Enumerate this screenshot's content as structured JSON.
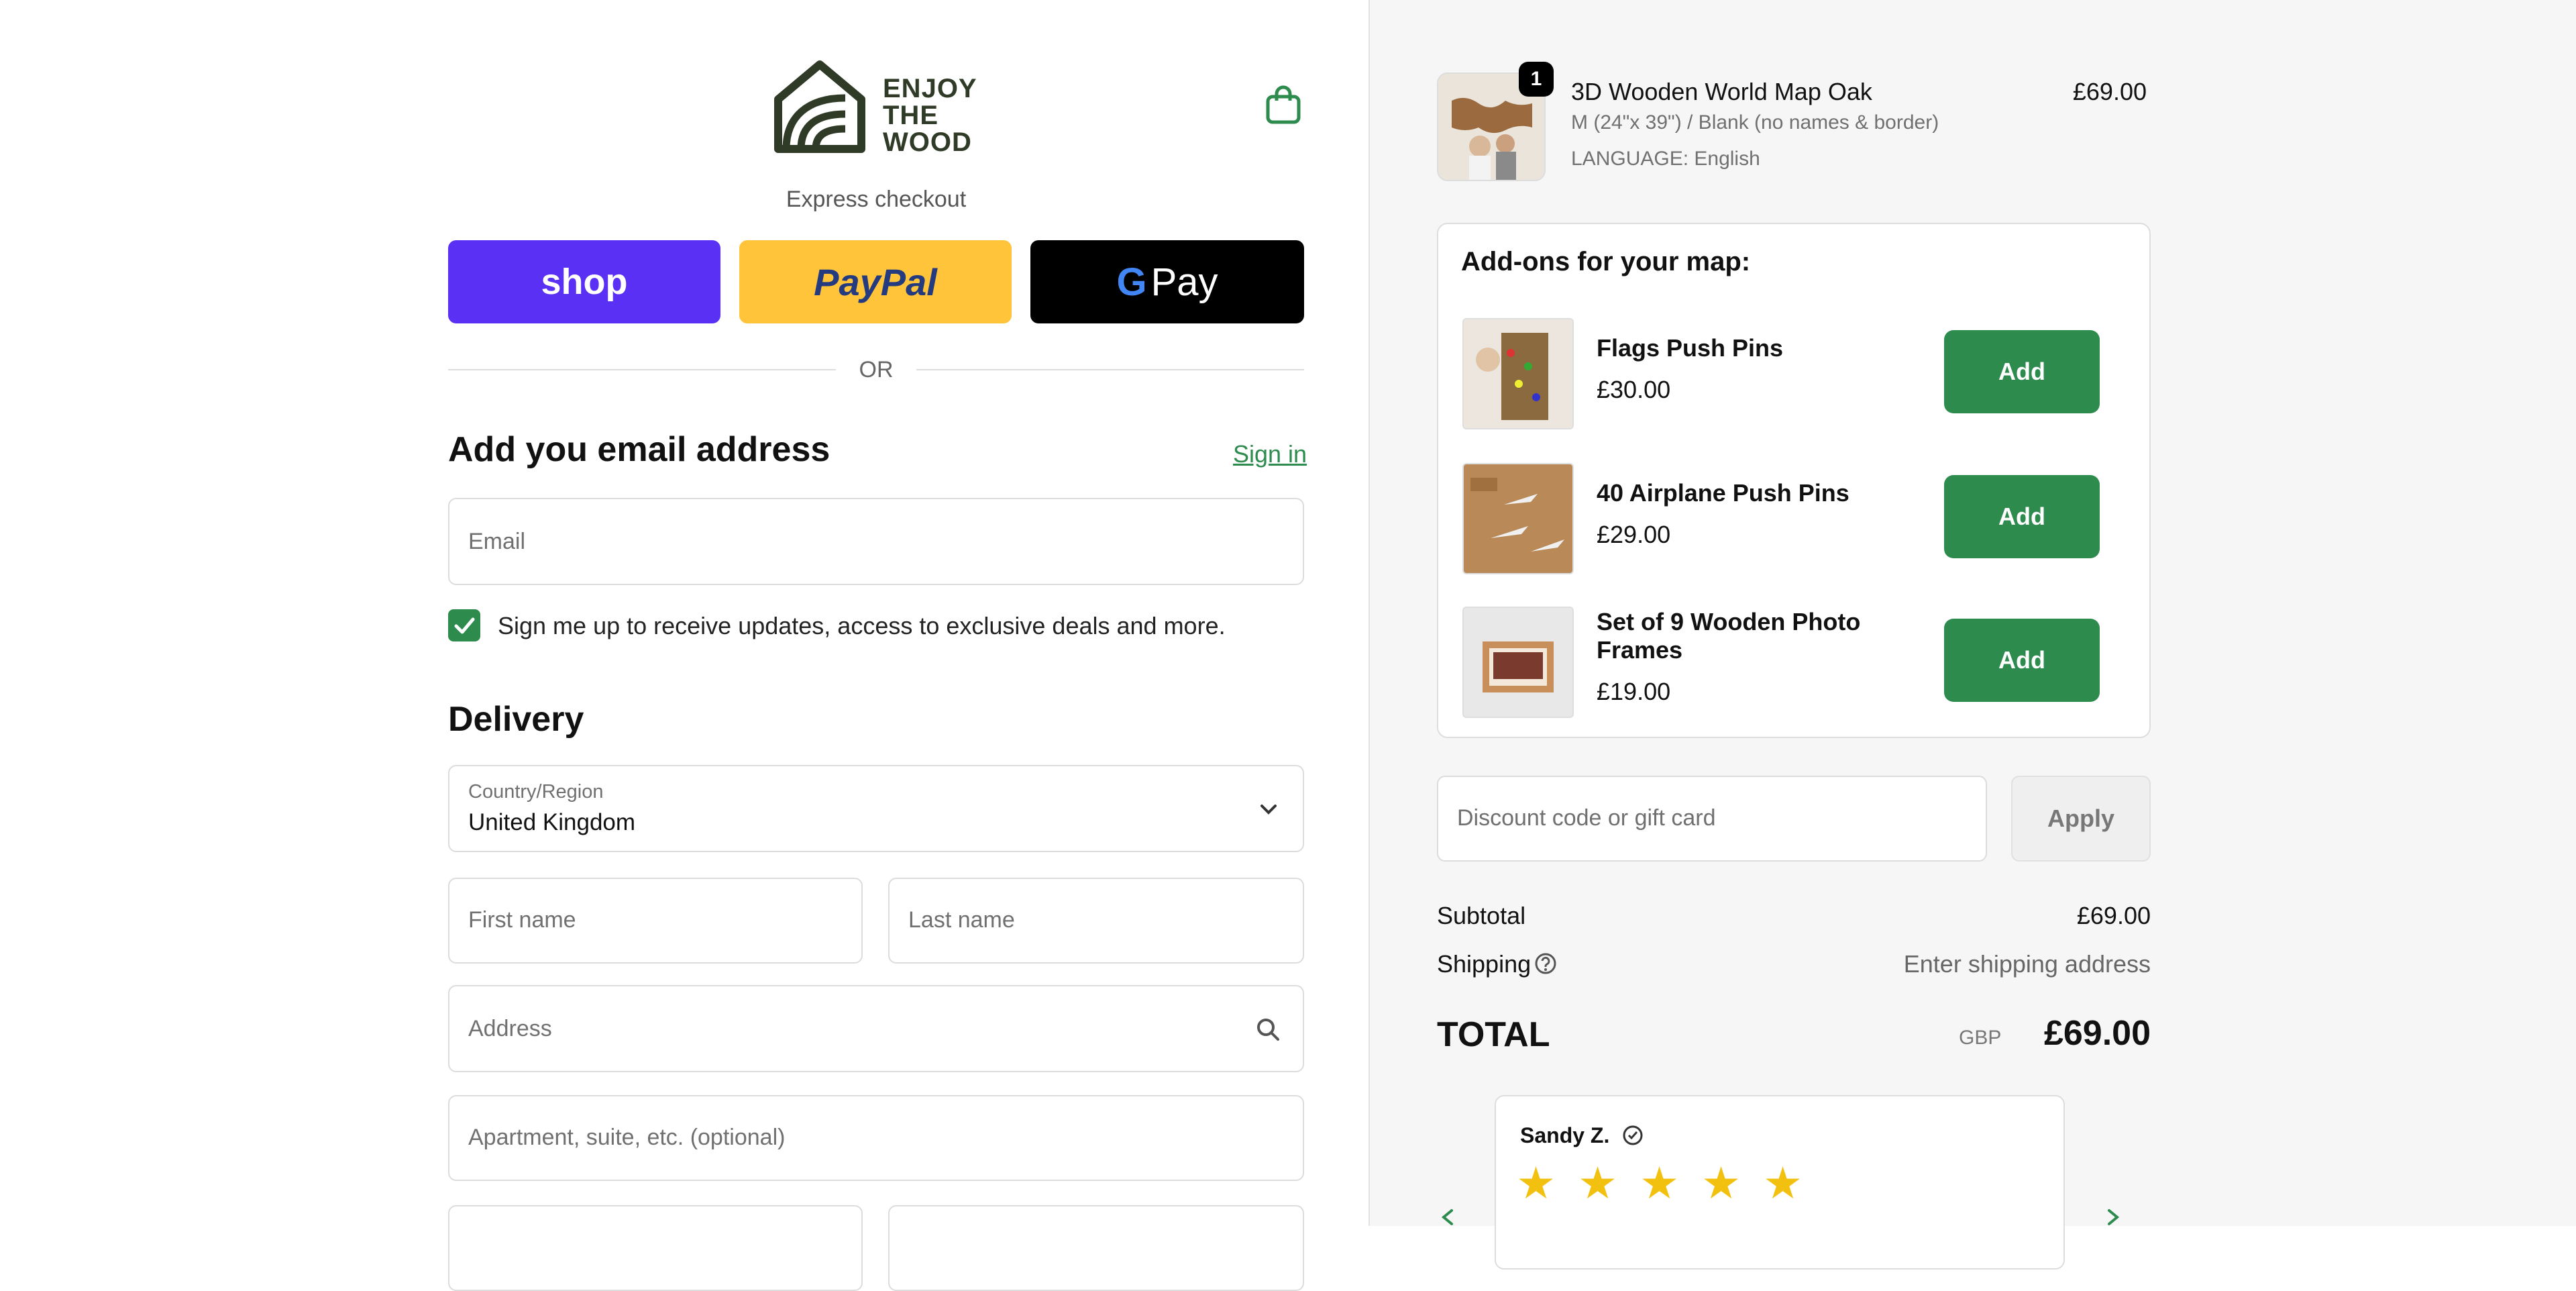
{
  "brand": {
    "name_line1": "ENJOY",
    "name_line2": "THE",
    "name_line3": "WOOD"
  },
  "express": {
    "label": "Express checkout",
    "shop_label": "shop",
    "paypal_label": "PayPal",
    "gpay_label": "Pay",
    "gpay_g": "G",
    "or_label": "OR"
  },
  "email_section": {
    "title": "Add you email address",
    "sign_in": "Sign in",
    "email_placeholder": "Email",
    "newsletter_label": "Sign me up to receive updates, access to exclusive deals and more.",
    "newsletter_checked": true
  },
  "delivery": {
    "title": "Delivery",
    "country_label": "Country/Region",
    "country_value": "United Kingdom",
    "first_name_placeholder": "First name",
    "last_name_placeholder": "Last name",
    "address_placeholder": "Address",
    "apartment_placeholder": "Apartment, suite, etc. (optional)"
  },
  "order": {
    "item": {
      "quantity": "1",
      "name": "3D Wooden World Map Oak",
      "variant": "M (24\"x 39\") / Blank (no names & border)",
      "language": "LANGUAGE: English",
      "price": "£69.00"
    },
    "addons": {
      "title": "Add-ons for your map:",
      "items": [
        {
          "name": "Flags Push Pins",
          "price": "£30.00",
          "button": "Add"
        },
        {
          "name": "40 Airplane Push Pins",
          "price": "£29.00",
          "button": "Add"
        },
        {
          "name": "Set of 9 Wooden Photo Frames",
          "price": "£19.00",
          "button": "Add"
        }
      ]
    },
    "discount": {
      "placeholder": "Discount code or gift card",
      "apply_label": "Apply"
    },
    "summary": {
      "subtotal_label": "Subtotal",
      "subtotal_value": "£69.00",
      "shipping_label": "Shipping",
      "shipping_value": "Enter shipping address",
      "total_label": "TOTAL",
      "currency": "GBP",
      "total_value": "£69.00"
    },
    "review": {
      "author": "Sandy Z.",
      "rating": 5
    }
  },
  "colors": {
    "accent": "#2e8b4e",
    "shop": "#5a31f4",
    "paypal": "#ffc439",
    "gpay": "#000000",
    "star": "#f2c10f"
  }
}
